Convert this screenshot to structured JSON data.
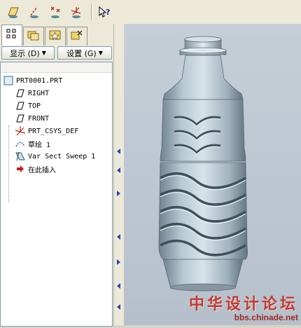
{
  "toolbar": {
    "buttons": [
      {
        "icon": "datum-plane-display-icon"
      },
      {
        "icon": "datum-axis-display-icon"
      },
      {
        "icon": "datum-point-display-icon"
      },
      {
        "icon": "coordinate-system-display-icon"
      },
      {
        "icon": "context-help-icon"
      }
    ]
  },
  "panel": {
    "tabs": [
      {
        "icon": "model-tree-icon"
      },
      {
        "icon": "folder-browser-icon"
      },
      {
        "icon": "favorites-icon"
      },
      {
        "icon": "connections-icon"
      }
    ],
    "show_menu_label": "显示 (D)",
    "settings_menu_label": "设置 (G)",
    "tree": [
      {
        "label": "PRT0001.PRT",
        "icon": "part-icon"
      },
      {
        "label": "RIGHT",
        "icon": "datum-plane-icon"
      },
      {
        "label": "TOP",
        "icon": "datum-plane-icon"
      },
      {
        "label": "FRONT",
        "icon": "datum-plane-icon"
      },
      {
        "label": "PRT_CSYS_DEF",
        "icon": "csys-icon"
      },
      {
        "label": "草绘 1",
        "icon": "sketch-icon"
      },
      {
        "label": "Var Sect Sweep 1",
        "icon": "sweep-icon"
      },
      {
        "label": "在此插入",
        "icon": "insert-here-arrow-icon"
      }
    ]
  },
  "watermark": {
    "title": "中华设计论坛",
    "url": "bbs.chinade.net"
  },
  "colors": {
    "accent": "#2f3fb0",
    "insert_arrow": "#c0201a",
    "watermark": "#c63a2f"
  }
}
